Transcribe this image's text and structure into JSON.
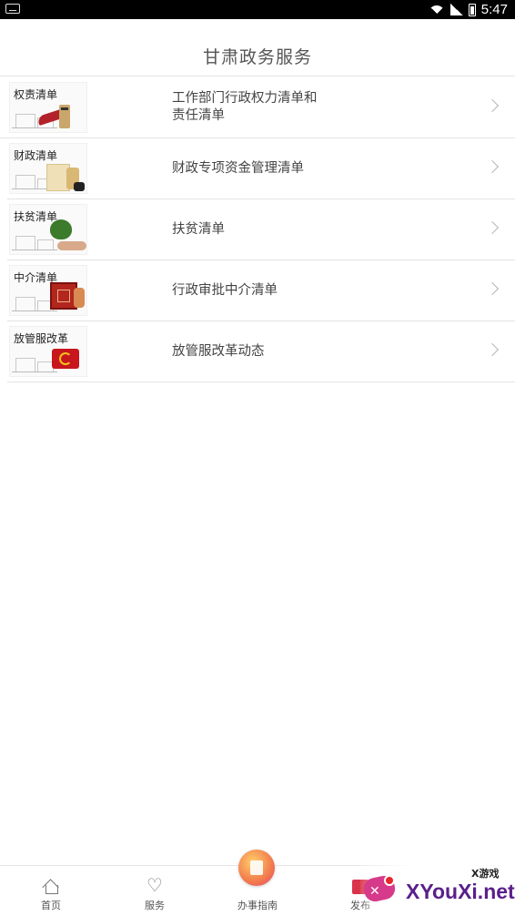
{
  "status_bar": {
    "time": "5:47",
    "icons": [
      "keyboard-icon",
      "wifi-icon",
      "signal-icon",
      "battery-icon"
    ]
  },
  "header": {
    "title": "甘肃政务服务"
  },
  "list": {
    "items": [
      {
        "thumb_label": "权责清单",
        "text_line1": "工作部门行政权力清单和",
        "text_line2": "责任清单"
      },
      {
        "thumb_label": "财政清单",
        "text_line1": "财政专项资金管理清单",
        "text_line2": ""
      },
      {
        "thumb_label": "扶贫清单",
        "text_line1": "扶贫清单",
        "text_line2": ""
      },
      {
        "thumb_label": "中介清单",
        "text_line1": "行政审批中介清单",
        "text_line2": ""
      },
      {
        "thumb_label": "放管服改革",
        "text_line1": "放管服改革动态",
        "text_line2": ""
      }
    ]
  },
  "tabbar": {
    "home": "首页",
    "service": "服务",
    "guide": "办事指南",
    "publish": "发布"
  },
  "watermark": {
    "brand": "XYouXi.net",
    "tagline": "X游戏"
  },
  "colors": {
    "accent_red": "#c8161d",
    "text": "#444444",
    "watermark_purple": "#5a1f8a"
  }
}
